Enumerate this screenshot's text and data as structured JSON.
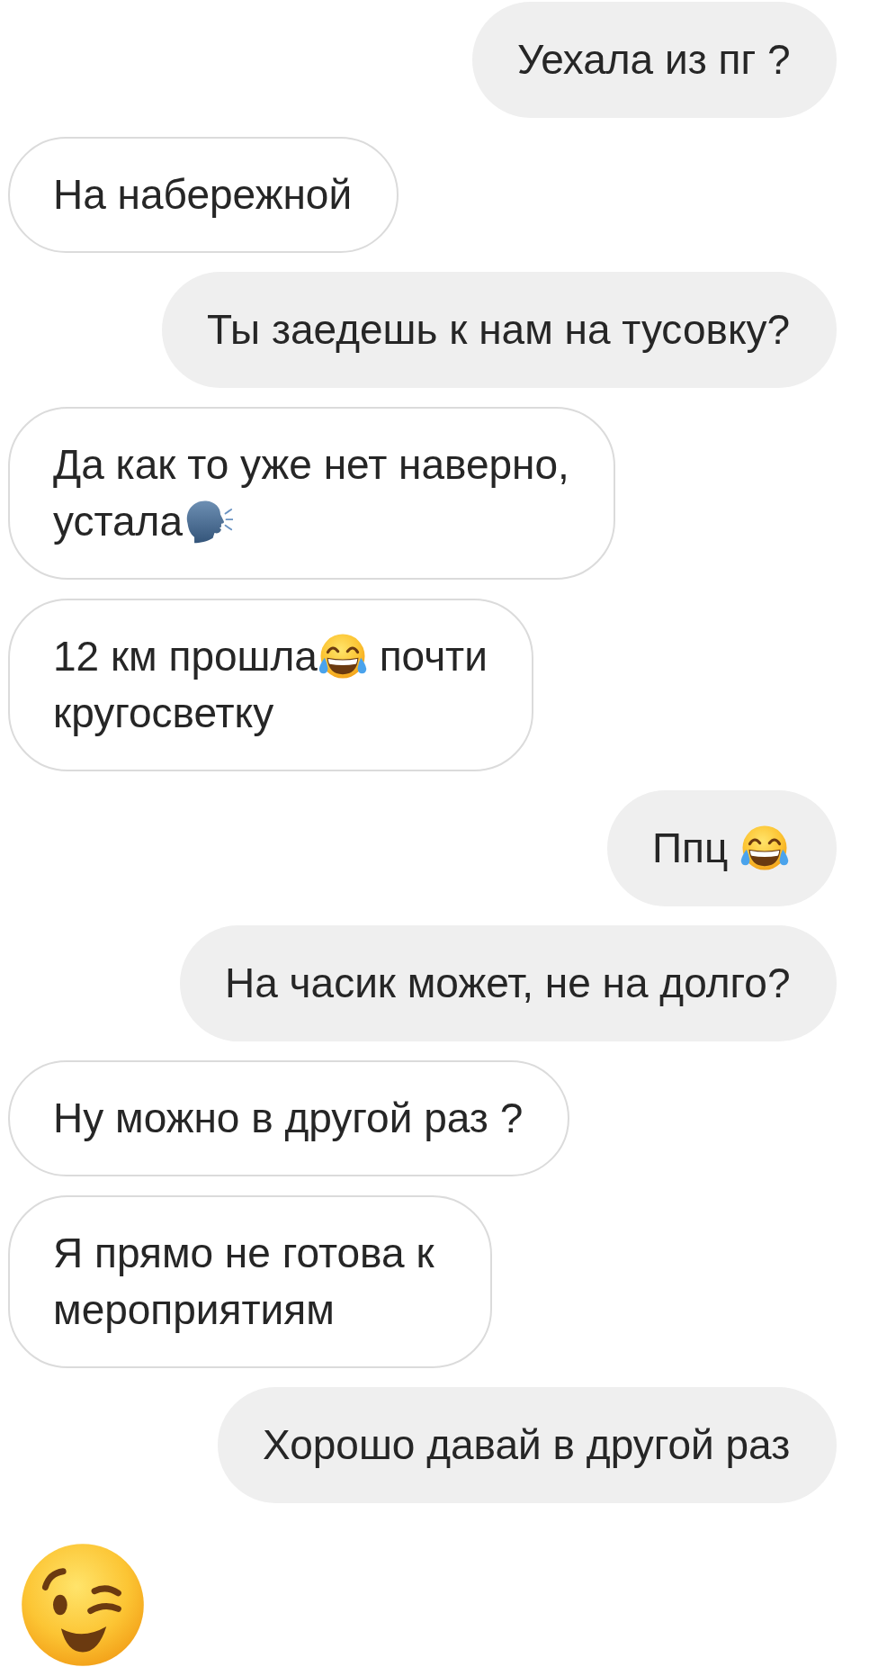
{
  "messages": [
    {
      "kind": "sent",
      "parts": [
        {
          "kind": "text",
          "text": "Уехала из пг ?"
        }
      ]
    },
    {
      "kind": "received",
      "parts": [
        {
          "kind": "text",
          "text": "На набережной"
        }
      ]
    },
    {
      "kind": "sent",
      "parts": [
        {
          "kind": "text",
          "text": "Ты заедешь к нам на тусовку?"
        }
      ]
    },
    {
      "kind": "received",
      "parts": [
        {
          "kind": "text",
          "text": "Да как то уже нет наверно,"
        },
        {
          "kind": "line_break"
        },
        {
          "kind": "text",
          "text": "устала"
        },
        {
          "kind": "speaking_head"
        }
      ]
    },
    {
      "kind": "received",
      "parts": [
        {
          "kind": "text",
          "text": "12 км прошла"
        },
        {
          "kind": "tears_of_joy"
        },
        {
          "kind": "text",
          "text": " почти"
        },
        {
          "kind": "line_break"
        },
        {
          "kind": "text",
          "text": "кругосветку"
        }
      ]
    },
    {
      "kind": "sent",
      "parts": [
        {
          "kind": "text",
          "text": "Ппц "
        },
        {
          "kind": "tears_of_joy"
        }
      ]
    },
    {
      "kind": "sent",
      "parts": [
        {
          "kind": "text",
          "text": "На часик может, не на долго?"
        }
      ]
    },
    {
      "kind": "received",
      "parts": [
        {
          "kind": "text",
          "text": "Ну можно в другой раз ?"
        }
      ]
    },
    {
      "kind": "received",
      "parts": [
        {
          "kind": "text",
          "text": "Я прямо не готова к мероприятиям"
        }
      ]
    },
    {
      "kind": "sent",
      "parts": [
        {
          "kind": "text",
          "text": "Хорошо давай в другой раз"
        }
      ]
    },
    {
      "kind": "received_emoji",
      "parts": [
        {
          "kind": "winking_face"
        }
      ]
    }
  ]
}
